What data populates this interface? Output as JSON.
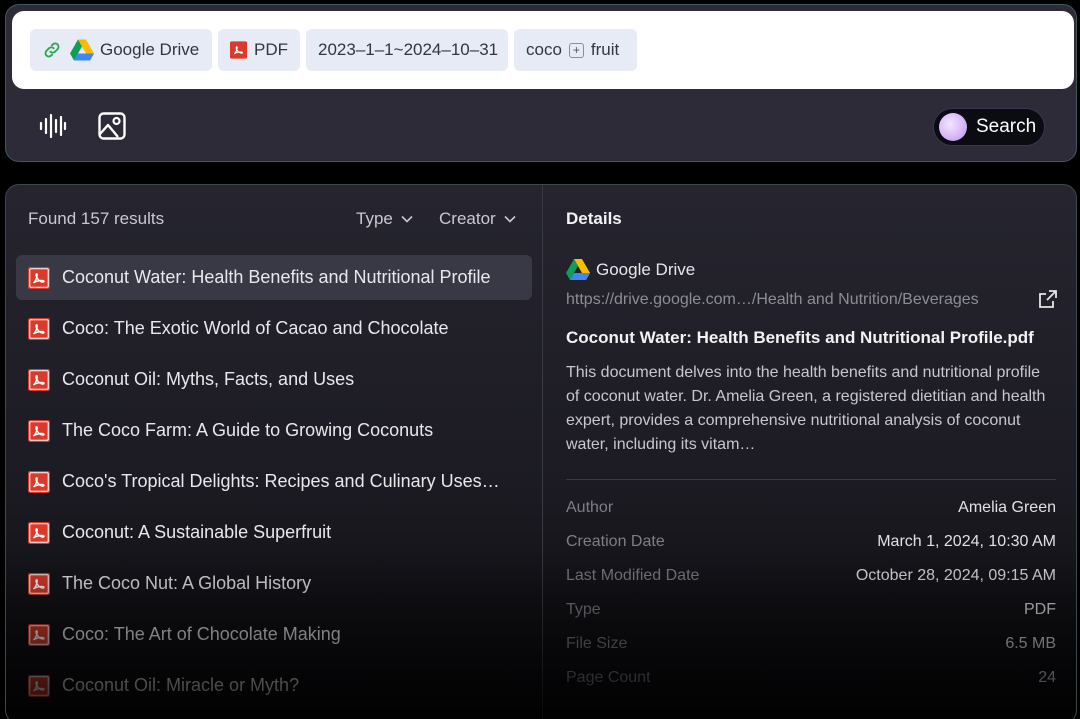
{
  "search": {
    "chips": {
      "source_label": "Google Drive",
      "type_label": "PDF",
      "date_range": "2023–1–1~2024–10–31",
      "query_term_1": "coco",
      "query_operator": "+",
      "query_term_2": "fruit"
    },
    "search_button_label": "Search"
  },
  "results": {
    "count_label": "Found 157 results",
    "filters": {
      "type_label": "Type",
      "creator_label": "Creator"
    },
    "items": [
      {
        "title": "Coconut Water: Health Benefits and Nutritional Profile"
      },
      {
        "title": "Coco: The Exotic World of Cacao and Chocolate"
      },
      {
        "title": "Coconut Oil: Myths, Facts, and Uses"
      },
      {
        "title": "The Coco Farm: A Guide to Growing Coconuts"
      },
      {
        "title": "Coco's Tropical Delights: Recipes and Culinary Uses…"
      },
      {
        "title": "Coconut: A Sustainable Superfruit"
      },
      {
        "title": "The Coco Nut: A Global History"
      },
      {
        "title": "Coco: The Art of Chocolate Making"
      },
      {
        "title": "Coconut Oil: Miracle or Myth?"
      }
    ],
    "selected_index": 0
  },
  "details": {
    "heading": "Details",
    "source": "Google Drive",
    "path": "https://drive.google.com…/Health and Nutrition/Beverages",
    "file_title": "Coconut Water: Health Benefits and Nutritional Profile.pdf",
    "description": "This document delves into the health benefits and nutritional profile of coconut water. Dr. Amelia Green, a registered dietitian and health expert, provides a comprehensive nutritional analysis of coconut water, including its vitam…",
    "metadata": [
      {
        "key": "Author",
        "value": "Amelia Green"
      },
      {
        "key": "Creation Date",
        "value": "March 1, 2024, 10:30 AM"
      },
      {
        "key": "Last Modified Date",
        "value": "October 28, 2024, 09:15 AM"
      },
      {
        "key": "Type",
        "value": "PDF"
      },
      {
        "key": "File Size",
        "value": "6.5 MB"
      },
      {
        "key": "Page Count",
        "value": "24"
      }
    ]
  },
  "icons": {
    "link": "link-icon",
    "drive": "google-drive-icon",
    "pdf": "pdf-icon",
    "voice": "voice-waveform-icon",
    "image": "image-icon",
    "chevron": "chevron-down-icon",
    "external": "external-link-icon"
  },
  "colors": {
    "pdf_red": "#d93a2b",
    "link_green": "#2fa84f",
    "search_orb": "#d8b8f8"
  }
}
